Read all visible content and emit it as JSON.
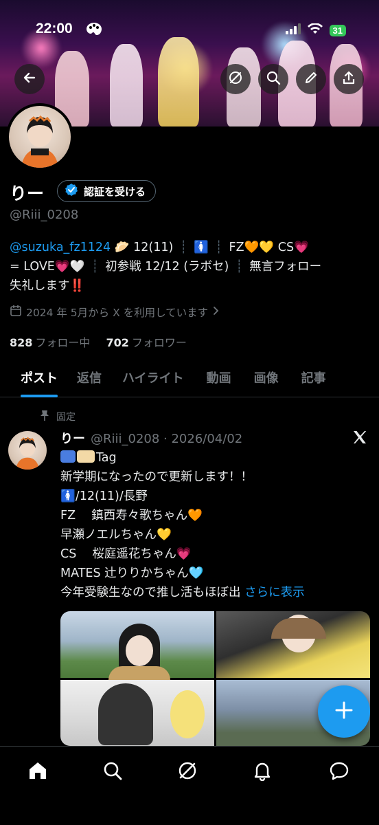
{
  "status_bar": {
    "time": "22:00",
    "battery": "31"
  },
  "profile": {
    "name": "りー",
    "verify_label": "認証を受ける",
    "handle": "@Riii_0208",
    "bio": {
      "mention": "@suzuka_fz1124",
      "age": "12(11)",
      "fz": "FZ",
      "cs": "CS",
      "love": "= LOVE",
      "first": "初参戦 12/12 (ラボセ)",
      "silent": "無言フォロー",
      "line3": "失礼します"
    },
    "joined": "2024 年 5月から X を利用しています",
    "following_count": "828",
    "following_label": "フォロー中",
    "followers_count": "702",
    "followers_label": "フォロワー"
  },
  "tabs": [
    "ポスト",
    "返信",
    "ハイライト",
    "動画",
    "画像",
    "記事"
  ],
  "post": {
    "pinned_label": "固定",
    "name": "りー",
    "meta": "@Riii_0208 · 2026/04/02",
    "lines": [
      "Tag",
      "新学期になったので更新します！！",
      "/12(11)/長野",
      "FZ　  鎮西寿々歌ちゃん",
      "早瀬ノエルちゃん",
      "CS　  桜庭遥花ちゃん",
      "MATES 辻りりかちゃん",
      "今年受験生なので推し活もほぼ出"
    ],
    "more_label": "さらに表示"
  },
  "icons": {
    "back": "back-arrow-icon",
    "grok": "grok-icon",
    "search": "search-icon",
    "edit": "pencil-icon",
    "share": "share-icon",
    "calendar": "calendar-icon",
    "verified": "verified-badge-icon",
    "pin": "pin-icon",
    "x": "x-logo-icon",
    "compose": "plus-icon",
    "home": "home-icon",
    "nav_search": "search-icon",
    "nav_grok": "grok-icon",
    "notifications": "bell-icon",
    "messages": "chat-bubble-icon"
  },
  "colors": {
    "accent": "#1d9bf0",
    "background": "#000000",
    "secondary_text": "#71767b"
  }
}
